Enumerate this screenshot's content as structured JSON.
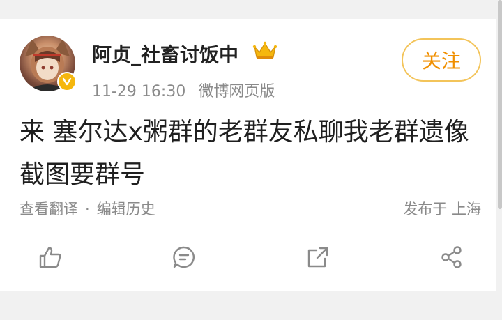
{
  "post": {
    "username": "阿贞_社畜讨饭中",
    "time": "11-29 16:30",
    "source": "微博网页版",
    "follow_label": "关注",
    "text": "来 塞尔达x粥群的老群友私聊我老群遗像截图要群号",
    "translate_label": "查看翻译",
    "separator": "·",
    "edit_history_label": "编辑历史",
    "location": "发布于 上海"
  },
  "icons": {
    "like": "thumbs-up-icon",
    "comment": "comment-icon",
    "share": "share-out-icon",
    "more_share": "share-nodes-icon",
    "badge": "crown-icon",
    "verified": "verified-v-icon"
  },
  "colors": {
    "accent": "#f08f00",
    "follow_border": "#f3c45a",
    "verified": "#f5b70e",
    "meta_text": "#8a8a8a"
  }
}
